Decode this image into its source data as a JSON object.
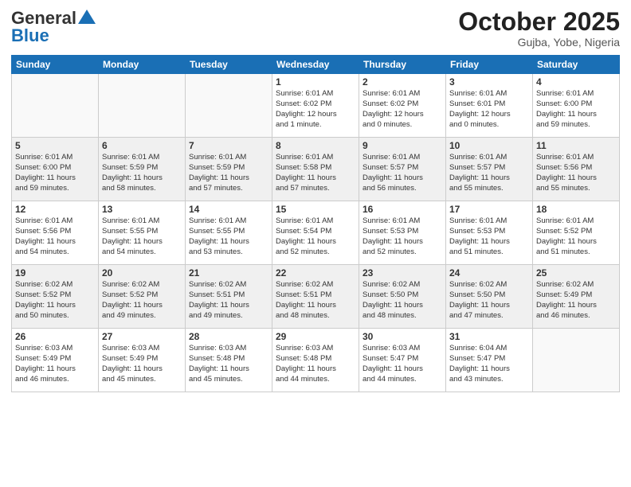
{
  "header": {
    "logo_general": "General",
    "logo_blue": "Blue",
    "month": "October 2025",
    "location": "Gujba, Yobe, Nigeria"
  },
  "weekdays": [
    "Sunday",
    "Monday",
    "Tuesday",
    "Wednesday",
    "Thursday",
    "Friday",
    "Saturday"
  ],
  "weeks": [
    [
      {
        "day": "",
        "info": ""
      },
      {
        "day": "",
        "info": ""
      },
      {
        "day": "",
        "info": ""
      },
      {
        "day": "1",
        "info": "Sunrise: 6:01 AM\nSunset: 6:02 PM\nDaylight: 12 hours\nand 1 minute."
      },
      {
        "day": "2",
        "info": "Sunrise: 6:01 AM\nSunset: 6:02 PM\nDaylight: 12 hours\nand 0 minutes."
      },
      {
        "day": "3",
        "info": "Sunrise: 6:01 AM\nSunset: 6:01 PM\nDaylight: 12 hours\nand 0 minutes."
      },
      {
        "day": "4",
        "info": "Sunrise: 6:01 AM\nSunset: 6:00 PM\nDaylight: 11 hours\nand 59 minutes."
      }
    ],
    [
      {
        "day": "5",
        "info": "Sunrise: 6:01 AM\nSunset: 6:00 PM\nDaylight: 11 hours\nand 59 minutes."
      },
      {
        "day": "6",
        "info": "Sunrise: 6:01 AM\nSunset: 5:59 PM\nDaylight: 11 hours\nand 58 minutes."
      },
      {
        "day": "7",
        "info": "Sunrise: 6:01 AM\nSunset: 5:59 PM\nDaylight: 11 hours\nand 57 minutes."
      },
      {
        "day": "8",
        "info": "Sunrise: 6:01 AM\nSunset: 5:58 PM\nDaylight: 11 hours\nand 57 minutes."
      },
      {
        "day": "9",
        "info": "Sunrise: 6:01 AM\nSunset: 5:57 PM\nDaylight: 11 hours\nand 56 minutes."
      },
      {
        "day": "10",
        "info": "Sunrise: 6:01 AM\nSunset: 5:57 PM\nDaylight: 11 hours\nand 55 minutes."
      },
      {
        "day": "11",
        "info": "Sunrise: 6:01 AM\nSunset: 5:56 PM\nDaylight: 11 hours\nand 55 minutes."
      }
    ],
    [
      {
        "day": "12",
        "info": "Sunrise: 6:01 AM\nSunset: 5:56 PM\nDaylight: 11 hours\nand 54 minutes."
      },
      {
        "day": "13",
        "info": "Sunrise: 6:01 AM\nSunset: 5:55 PM\nDaylight: 11 hours\nand 54 minutes."
      },
      {
        "day": "14",
        "info": "Sunrise: 6:01 AM\nSunset: 5:55 PM\nDaylight: 11 hours\nand 53 minutes."
      },
      {
        "day": "15",
        "info": "Sunrise: 6:01 AM\nSunset: 5:54 PM\nDaylight: 11 hours\nand 52 minutes."
      },
      {
        "day": "16",
        "info": "Sunrise: 6:01 AM\nSunset: 5:53 PM\nDaylight: 11 hours\nand 52 minutes."
      },
      {
        "day": "17",
        "info": "Sunrise: 6:01 AM\nSunset: 5:53 PM\nDaylight: 11 hours\nand 51 minutes."
      },
      {
        "day": "18",
        "info": "Sunrise: 6:01 AM\nSunset: 5:52 PM\nDaylight: 11 hours\nand 51 minutes."
      }
    ],
    [
      {
        "day": "19",
        "info": "Sunrise: 6:02 AM\nSunset: 5:52 PM\nDaylight: 11 hours\nand 50 minutes."
      },
      {
        "day": "20",
        "info": "Sunrise: 6:02 AM\nSunset: 5:52 PM\nDaylight: 11 hours\nand 49 minutes."
      },
      {
        "day": "21",
        "info": "Sunrise: 6:02 AM\nSunset: 5:51 PM\nDaylight: 11 hours\nand 49 minutes."
      },
      {
        "day": "22",
        "info": "Sunrise: 6:02 AM\nSunset: 5:51 PM\nDaylight: 11 hours\nand 48 minutes."
      },
      {
        "day": "23",
        "info": "Sunrise: 6:02 AM\nSunset: 5:50 PM\nDaylight: 11 hours\nand 48 minutes."
      },
      {
        "day": "24",
        "info": "Sunrise: 6:02 AM\nSunset: 5:50 PM\nDaylight: 11 hours\nand 47 minutes."
      },
      {
        "day": "25",
        "info": "Sunrise: 6:02 AM\nSunset: 5:49 PM\nDaylight: 11 hours\nand 46 minutes."
      }
    ],
    [
      {
        "day": "26",
        "info": "Sunrise: 6:03 AM\nSunset: 5:49 PM\nDaylight: 11 hours\nand 46 minutes."
      },
      {
        "day": "27",
        "info": "Sunrise: 6:03 AM\nSunset: 5:49 PM\nDaylight: 11 hours\nand 45 minutes."
      },
      {
        "day": "28",
        "info": "Sunrise: 6:03 AM\nSunset: 5:48 PM\nDaylight: 11 hours\nand 45 minutes."
      },
      {
        "day": "29",
        "info": "Sunrise: 6:03 AM\nSunset: 5:48 PM\nDaylight: 11 hours\nand 44 minutes."
      },
      {
        "day": "30",
        "info": "Sunrise: 6:03 AM\nSunset: 5:47 PM\nDaylight: 11 hours\nand 44 minutes."
      },
      {
        "day": "31",
        "info": "Sunrise: 6:04 AM\nSunset: 5:47 PM\nDaylight: 11 hours\nand 43 minutes."
      },
      {
        "day": "",
        "info": ""
      }
    ]
  ]
}
